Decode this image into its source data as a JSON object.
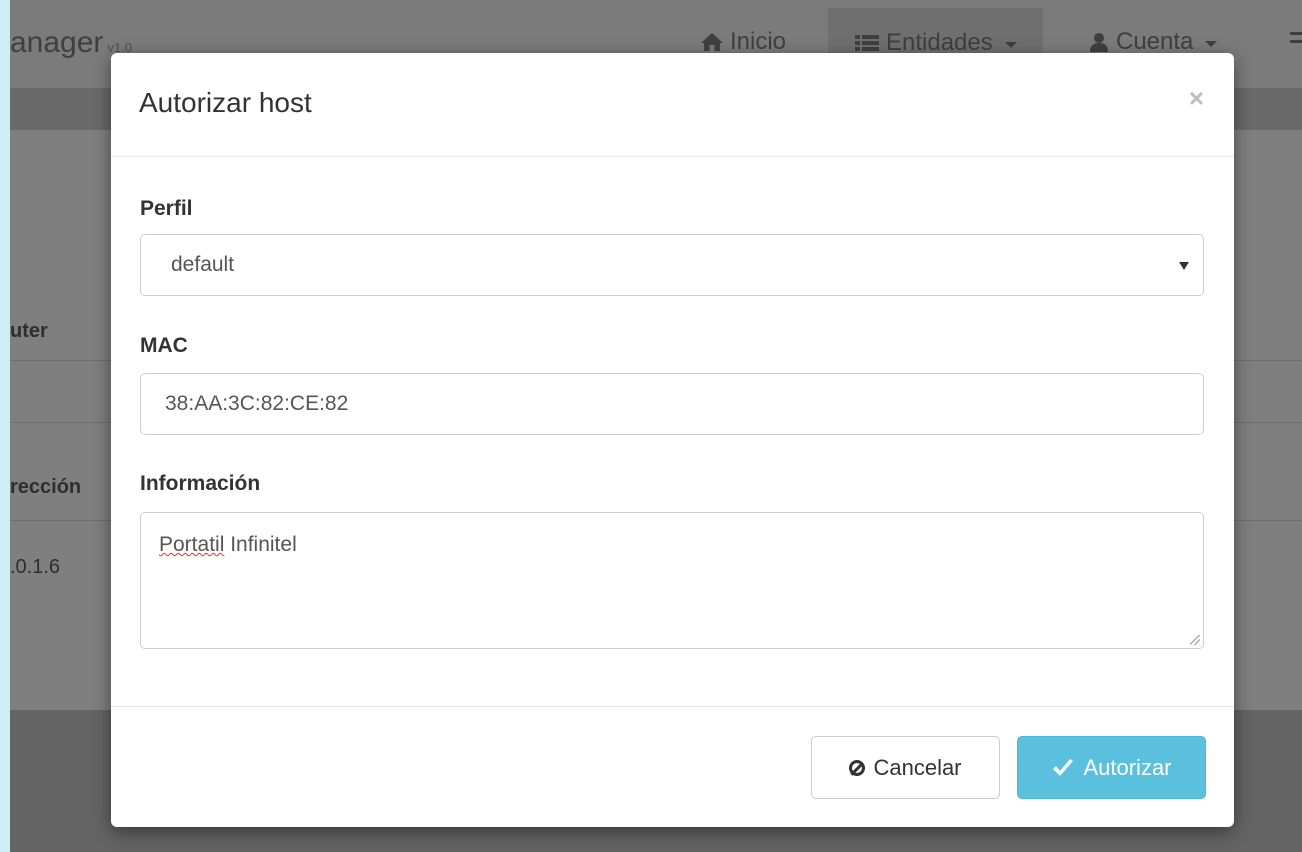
{
  "background": {
    "brand": "anager",
    "brand_version": "v1.0",
    "nav": {
      "inicio": "Inicio",
      "entidades": "Entidades",
      "cuenta": "Cuenta"
    },
    "table": {
      "col_router": "uter",
      "col_direccion": "rección",
      "ip_value": ".0.1.6"
    }
  },
  "modal": {
    "title": "Autorizar host",
    "close_symbol": "×",
    "perfil_label": "Perfil",
    "perfil_value": "default",
    "mac_label": "MAC",
    "mac_value": "38:AA:3C:82:CE:82",
    "info_label": "Información",
    "info_value_word1": "Portatil",
    "info_value_word2": " Infinitel",
    "cancel_label": "Cancelar",
    "submit_label": "Autorizar"
  },
  "colors": {
    "overlay": "#7f7f7f",
    "primary_button": "#5bc0de",
    "page_edge": "#cdeef6"
  },
  "icons": {
    "inicio": "home-icon",
    "entidades": "list-icon",
    "cuenta": "user-icon",
    "cancel": "ban-icon",
    "submit": "check-icon"
  }
}
